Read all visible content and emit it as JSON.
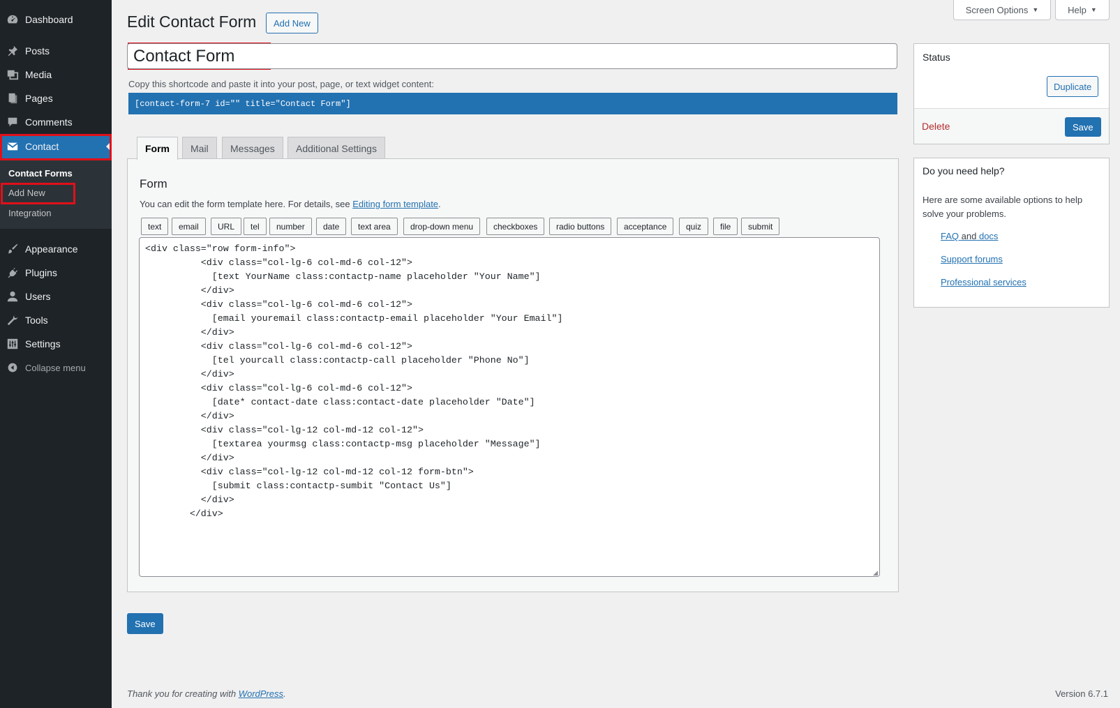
{
  "sidebar": {
    "items": [
      {
        "id": "dashboard",
        "label": "Dashboard",
        "icon": "dashboard-icon"
      },
      {
        "id": "posts",
        "label": "Posts",
        "icon": "pin-icon"
      },
      {
        "id": "media",
        "label": "Media",
        "icon": "media-icon"
      },
      {
        "id": "pages",
        "label": "Pages",
        "icon": "page-icon"
      },
      {
        "id": "comments",
        "label": "Comments",
        "icon": "comment-icon"
      },
      {
        "id": "contact",
        "label": "Contact",
        "icon": "envelope-icon"
      },
      {
        "id": "appearance",
        "label": "Appearance",
        "icon": "brush-icon"
      },
      {
        "id": "plugins",
        "label": "Plugins",
        "icon": "plug-icon"
      },
      {
        "id": "users",
        "label": "Users",
        "icon": "user-icon"
      },
      {
        "id": "tools",
        "label": "Tools",
        "icon": "wrench-icon"
      },
      {
        "id": "settings",
        "label": "Settings",
        "icon": "sliders-icon"
      },
      {
        "id": "collapse",
        "label": "Collapse menu",
        "icon": "collapse-arrow-icon"
      }
    ],
    "submenu": [
      {
        "label": "Contact Forms",
        "current": true
      },
      {
        "label": "Add New",
        "current": false
      },
      {
        "label": "Integration",
        "current": false
      }
    ]
  },
  "top_buttons": {
    "screen_options": "Screen Options",
    "help": "Help"
  },
  "page": {
    "title": "Edit Contact Form",
    "add_new": "Add New",
    "form_title_value": "Contact Form",
    "shortcode_label": "Copy this shortcode and paste it into your post, page, or text widget content:",
    "shortcode": "[contact-form-7 id=\"\" title=\"Contact Form\"]"
  },
  "tabs": [
    "Form",
    "Mail",
    "Messages",
    "Additional Settings"
  ],
  "form_panel": {
    "heading": "Form",
    "desc_prefix": "You can edit the form template here. For details, see ",
    "desc_link": "Editing form template",
    "desc_suffix": ".",
    "tag_buttons": [
      "text",
      "email",
      "URL",
      "tel",
      "number",
      "date",
      "text area",
      "drop-down menu",
      "checkboxes",
      "radio buttons",
      "acceptance",
      "quiz",
      "file",
      "submit"
    ],
    "template": "<div class=\"row form-info\">\n          <div class=\"col-lg-6 col-md-6 col-12\">\n            [text YourName class:contactp-name placeholder \"Your Name\"]\n          </div>\n          <div class=\"col-lg-6 col-md-6 col-12\">\n            [email youremail class:contactp-email placeholder \"Your Email\"]\n          </div>\n          <div class=\"col-lg-6 col-md-6 col-12\">\n            [tel yourcall class:contactp-call placeholder \"Phone No\"]\n          </div>\n          <div class=\"col-lg-6 col-md-6 col-12\">\n            [date* contact-date class:contact-date placeholder \"Date\"]\n          </div>\n          <div class=\"col-lg-12 col-md-12 col-12\">\n            [textarea yourmsg class:contactp-msg placeholder \"Message\"]\n          </div>\n          <div class=\"col-lg-12 col-md-12 col-12 form-btn\">\n            [submit class:contactp-sumbit \"Contact Us\"]\n          </div>\n        </div>"
  },
  "save_label": "Save",
  "status_box": {
    "title": "Status",
    "duplicate": "Duplicate",
    "delete": "Delete",
    "save": "Save"
  },
  "help_box": {
    "title": "Do you need help?",
    "text": "Here are some available options to help solve your problems.",
    "faq": "FAQ",
    "and": "and",
    "docs": "docs",
    "support": "Support forums",
    "professional": "Professional services"
  },
  "footer": {
    "thanks_prefix": "Thank you for creating with ",
    "wordpress": "WordPress",
    "thanks_suffix": ".",
    "version": "Version 6.7.1"
  },
  "colors": {
    "sidebar_bg": "#1d2327",
    "accent": "#2271b1",
    "highlight": "#e0101a",
    "delete": "#b32d2e"
  }
}
